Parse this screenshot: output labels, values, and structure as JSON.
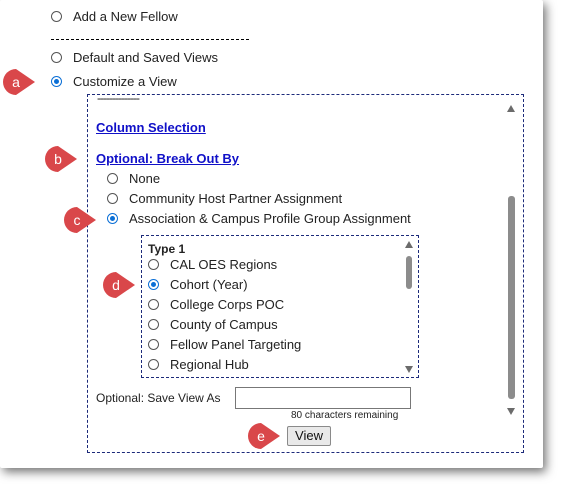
{
  "options": {
    "add_new_fellow": "Add a New Fellow",
    "default_saved_views": "Default and Saved Views",
    "customize_view": "Customize a View"
  },
  "customize": {
    "top_dashes": "--------------",
    "column_selection": "Column Selection",
    "breakout_title": "Optional: Break Out By",
    "breakout_options": [
      "None",
      "Community Host Partner Assignment",
      "Association & Campus Profile Group Assignment"
    ],
    "group_list": {
      "header": "Type 1",
      "items": [
        "CAL OES Regions",
        "Cohort (Year)",
        "College Corps POC",
        "County of Campus",
        "Fellow Panel Targeting",
        "Regional Hub"
      ],
      "selected": "Cohort (Year)"
    },
    "save_view_label": "Optional: Save View As",
    "save_view_value": "",
    "chars_remaining": "80 characters remaining",
    "view_button": "View"
  },
  "callouts": {
    "a": "a",
    "b": "b",
    "c": "c",
    "d": "d",
    "e": "e"
  },
  "colors": {
    "callout": "#d9474a",
    "link": "#1010c8",
    "radio_selected": "#0b6fd6"
  }
}
